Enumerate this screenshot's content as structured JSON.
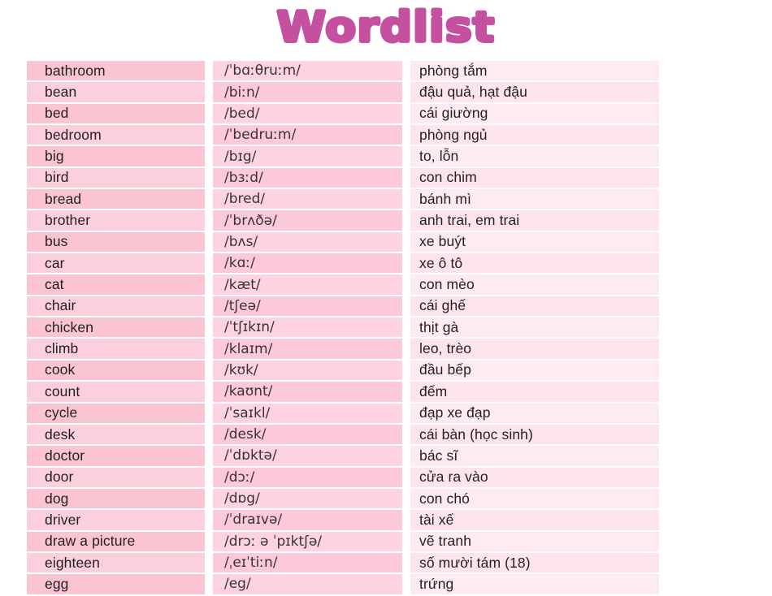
{
  "document": {
    "title": "Wordlist",
    "title_color": "#c4509f",
    "columns": [
      "word",
      "pronunciation",
      "meaning_vi"
    ],
    "row_colors": {
      "word_dark": "#fbc4d3",
      "word_light": "#fbcfdb",
      "ipa_dark": "#fcd3de",
      "ipa_light": "#fbc9d7",
      "vn_dark": "#fdebf0",
      "vn_light": "#fde4ec"
    }
  },
  "rows": [
    {
      "word": "bathroom",
      "ipa": "/ˈbɑːθruːm/",
      "vi": "phòng tắm"
    },
    {
      "word": "bean",
      "ipa": "/biːn/",
      "vi": "đậu quả, hạt đậu"
    },
    {
      "word": "bed",
      "ipa": "/bed/",
      "vi": "cái giường"
    },
    {
      "word": "bedroom",
      "ipa": "/ˈbedruːm/",
      "vi": "phòng ngủ"
    },
    {
      "word": "big",
      "ipa": "/bɪg/",
      "vi": "to, lỗn"
    },
    {
      "word": "bird",
      "ipa": "/bɜːd/",
      "vi": "con chim"
    },
    {
      "word": "bread",
      "ipa": "/bred/",
      "vi": "bánh mì"
    },
    {
      "word": "brother",
      "ipa": "/ˈbrʌðə/",
      "vi": "anh trai, em trai"
    },
    {
      "word": "bus",
      "ipa": "/bʌs/",
      "vi": "xe buýt"
    },
    {
      "word": "car",
      "ipa": "/kɑː/",
      "vi": "xe ô tô"
    },
    {
      "word": "cat",
      "ipa": "/kæt/",
      "vi": "con mèo"
    },
    {
      "word": "chair",
      "ipa": "/tʃeə/",
      "vi": "cái ghế"
    },
    {
      "word": "chicken",
      "ipa": "/ˈtʃɪkɪn/",
      "vi": "thịt gà"
    },
    {
      "word": "climb",
      "ipa": "/klaɪm/",
      "vi": "leo, trèo"
    },
    {
      "word": "cook",
      "ipa": "/kʊk/",
      "vi": "đầu bếp"
    },
    {
      "word": "count",
      "ipa": "/kaʊnt/",
      "vi": "đếm"
    },
    {
      "word": "cycle",
      "ipa": "/ˈsaɪkl/",
      "vi": "đạp xe đạp"
    },
    {
      "word": "desk",
      "ipa": "/desk/",
      "vi": "cái bàn (học sinh)"
    },
    {
      "word": "doctor",
      "ipa": "/ˈdɒktə/",
      "vi": "bác sĩ"
    },
    {
      "word": "door",
      "ipa": "/dɔː/",
      "vi": "cửa ra vào"
    },
    {
      "word": "dog",
      "ipa": "/dɒg/",
      "vi": "con chó"
    },
    {
      "word": "driver",
      "ipa": "/ˈdraɪvə/",
      "vi": "tài xế"
    },
    {
      "word": "draw a picture",
      "ipa": "/drɔː ə ˈpɪktʃə/",
      "vi": "vẽ tranh"
    },
    {
      "word": "eighteen",
      "ipa": "/ˌeɪˈtiːn/",
      "vi": "số mười tám (18)"
    },
    {
      "word": "egg",
      "ipa": "/eg/",
      "vi": "trứng"
    }
  ]
}
